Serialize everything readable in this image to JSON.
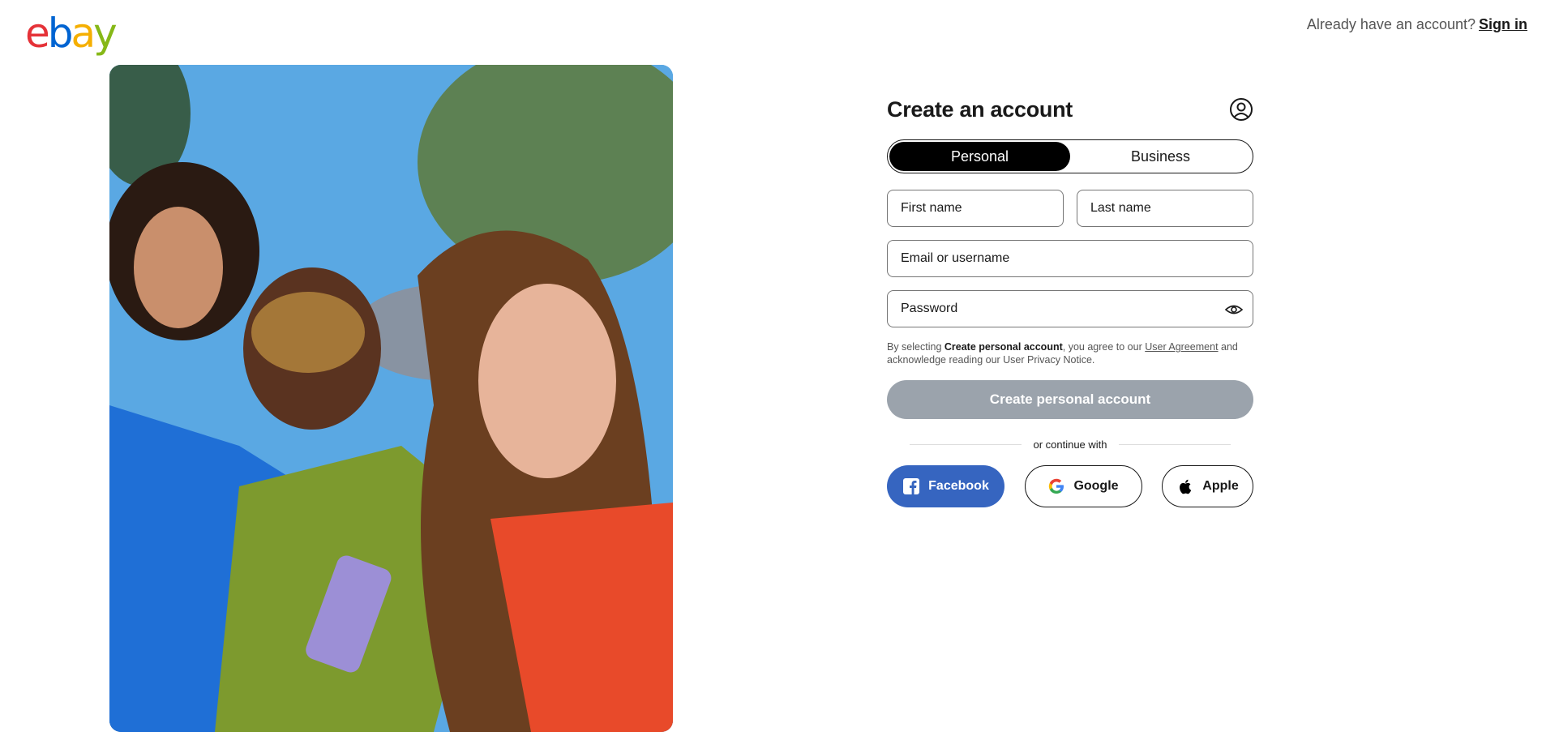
{
  "header": {
    "logo": {
      "letters": [
        "e",
        "b",
        "a",
        "y"
      ],
      "colors": [
        "#e53238",
        "#0064d2",
        "#f5af02",
        "#86b817"
      ]
    },
    "signin_prompt": "Already have an account?",
    "signin_link": "Sign in"
  },
  "hero": {
    "icon": "people-photo"
  },
  "form": {
    "title": "Create an account",
    "account_icon": "user-circle-icon",
    "tabs": [
      "Personal",
      "Business"
    ],
    "active_tab": "Personal",
    "first_name": {
      "placeholder": "First name",
      "value": ""
    },
    "last_name": {
      "placeholder": "Last name",
      "value": ""
    },
    "email": {
      "placeholder": "Email or username",
      "value": ""
    },
    "password": {
      "placeholder": "Password",
      "value": ""
    },
    "legal": {
      "prefix": "By selecting ",
      "bold": "Create personal account",
      "middle": ", you agree to our ",
      "link": "User Agreement",
      "suffix": " and acknowledge reading our User Privacy Notice."
    },
    "create_button": "Create personal account",
    "divider_text": "or continue with",
    "social": {
      "facebook": "Facebook",
      "google": "Google",
      "apple": "Apple"
    }
  },
  "colors": {
    "facebook": "#3665c0",
    "disabled_button": "#9ba3ac",
    "text": "#191919"
  }
}
